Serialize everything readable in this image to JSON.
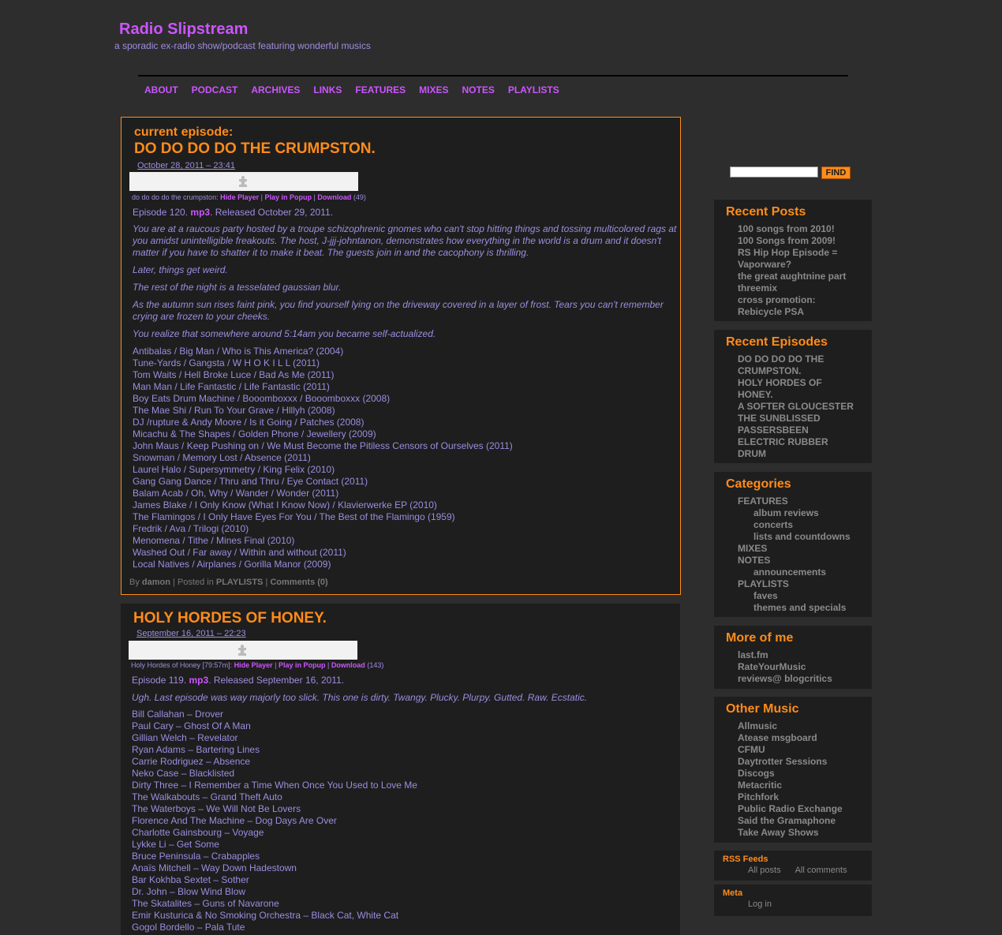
{
  "site": {
    "title": "Radio Slipstream",
    "description": "a sporadic ex-radio show/podcast featuring wonderful musics"
  },
  "nav": [
    "ABOUT",
    "PODCAST",
    "ARCHIVES",
    "LINKS",
    "FEATURES",
    "MIXES",
    "NOTES",
    "PLAYLISTS"
  ],
  "post1": {
    "label": "current episode:",
    "title": "DO DO DO DO THE CRUMPSTON.",
    "date": "October 28, 2011 – 23:41",
    "player_name": "do do do do the crumpston:",
    "hide_player": "Hide Player",
    "play_popup": "Play in Popup",
    "download": "Download",
    "download_count": "(49)",
    "episode_prefix": "Episode 120.",
    "mp3": "mp3",
    "episode_suffix": ". Released October 29, 2011.",
    "desc": [
      "You are at a raucous party hosted by a troupe schizophrenic gnomes who can't stop hitting things and tossing multicolored rags at you amidst unintelligible freakouts. The host, J-jjj-johntanon, demonstrates how everything in the world is a drum and it doesn't matter if you have to shatter it to make it beat. The guests join in and the cacophony is thrilling.",
      "Later, things get weird.",
      "The rest of the night is a tesselated gaussian blur.",
      "As the autumn sun rises faint pink, you find yourself lying on the driveway covered in a layer of frost. Tears you can't remember crying are frozen to your cheeks.",
      "You realize that somewhere around 5:14am you became self-actualized."
    ],
    "tracks": [
      "Antibalas / Big Man / Who is This America? (2004)",
      "Tune-Yards / Gangsta / W H O K I L L (2011)",
      "Tom Waits / Hell Broke Luce / Bad As Me (2011)",
      "Man Man / Life Fantastic / Life Fantastic (2011)",
      "Boy Eats Drum Machine / Booomboxxx / Booomboxxx (2008)",
      "The Mae Shi / Run To Your Grave / Hlllyh (2008)",
      "DJ /rupture & Andy Moore / Is it Going / Patches (2008)",
      "Micachu & The Shapes / Golden Phone / Jewellery (2009)",
      "John Maus / Keep Pushing on / We Must Become the Pitiless Censors of Ourselves (2011)",
      "Snowman / Memory Lost / Absence (2011)",
      "Laurel Halo / Supersymmetry / King Felix (2010)",
      "Gang Gang Dance / Thru and Thru / Eye Contact (2011)",
      "Balam Acab / Oh, Why / Wander / Wonder (2011)",
      "James Blake / I Only Know (What I Know Now) / Klavierwerke EP (2010)",
      "The Flamingos / I Only Have Eyes For You / The Best of the Flamingo (1959)",
      "Fredrik / Ava / Trilogi (2010)",
      "Menomena / Tithe / Mines Final (2010)",
      "Washed Out / Far away / Within and without (2011)",
      "Local Natives / Airplanes / Gorilla Manor (2009)"
    ],
    "meta_by": "By",
    "meta_author": "damon",
    "meta_posted": "| Posted in",
    "meta_category": "PLAYLISTS",
    "meta_sep": "|",
    "meta_comments": "Comments (0)"
  },
  "post2": {
    "title": "HOLY HORDES OF HONEY.",
    "date": "September 16, 2011 – 22:23",
    "player_name": "Holy Hordes of Honey [79:57m]:",
    "hide_player": "Hide Player",
    "play_popup": "Play in Popup",
    "download": "Download",
    "download_count": "(143)",
    "episode_prefix": "Episode 119.",
    "mp3": "mp3",
    "episode_suffix": ". Released September 16, 2011.",
    "desc": "Ugh. Last episode was way majorly too slick. This one is dirty. Twangy. Plucky. Plurpy. Gutted. Raw. Ecstatic.",
    "tracks": [
      "Bill Callahan – Drover",
      "Paul Cary – Ghost Of A Man",
      "Gillian Welch – Revelator",
      "Ryan Adams – Bartering Lines",
      "Carrie Rodriguez – Absence",
      "Neko Case – Blacklisted",
      "Dirty Three – I Remember a Time When Once You Used to Love Me",
      "The Walkabouts – Grand Theft Auto",
      "The Waterboys – We Will Not Be Lovers",
      "Florence And The Machine – Dog Days Are Over",
      "Charlotte Gainsbourg – Voyage",
      "Lykke Li – Get Some",
      "Bruce Peninsula – Crabapples",
      "Anaïs Mitchell – Way Down Hadestown",
      "Bar Kokhba Sextet – Sother",
      "Dr. John – Blow Wind Blow",
      "The Skatalites – Guns of Navarone",
      "Emir Kusturica & No Smoking Orchestra – Black Cat, White Cat",
      "Gogol Bordello – Pala Tute"
    ]
  },
  "search": {
    "button": "FIND"
  },
  "sidebar": {
    "recent_posts": {
      "title": "Recent Posts",
      "items": [
        "100 songs from 2010!",
        "100 Songs from 2009!",
        "RS Hip Hop Episode =",
        "Vaporware?",
        "the great aughtnine part",
        "threemix",
        "cross promotion:",
        "Rebicycle PSA"
      ]
    },
    "recent_episodes": {
      "title": "Recent Episodes",
      "items": [
        "DO DO DO DO THE",
        "CRUMPSTON.",
        "HOLY HORDES OF",
        "HONEY.",
        "A SOFTER GLOUCESTER",
        "THE SUNBLISSED",
        "PASSERSBEEN",
        "ELECTRIC RUBBER",
        "DRUM"
      ]
    },
    "categories": {
      "title": "Categories",
      "items": [
        {
          "label": "FEATURES",
          "sub": false
        },
        {
          "label": "album reviews",
          "sub": true
        },
        {
          "label": "concerts",
          "sub": true
        },
        {
          "label": "lists and countdowns",
          "sub": true
        },
        {
          "label": "MIXES",
          "sub": false
        },
        {
          "label": "NOTES",
          "sub": false
        },
        {
          "label": "announcements",
          "sub": true
        },
        {
          "label": "PLAYLISTS",
          "sub": false
        },
        {
          "label": "faves",
          "sub": true
        },
        {
          "label": "themes and specials",
          "sub": true
        }
      ]
    },
    "more_of_me": {
      "title": "More of me",
      "items": [
        "last.fm",
        "RateYourMusic",
        "reviews@ blogcritics"
      ]
    },
    "other_music": {
      "title": "Other Music",
      "items": [
        "Allmusic",
        "Atease msgboard",
        "CFMU",
        "Daytrotter Sessions",
        "Discogs",
        "Metacritic",
        "Pitchfork",
        "Public Radio Exchange",
        "Said the Gramaphone",
        "Take Away Shows"
      ]
    },
    "rss": {
      "title": "RSS Feeds",
      "all_posts": "All posts",
      "all_comments": "All comments"
    },
    "meta": {
      "title": "Meta",
      "log_in": "Log in"
    }
  },
  "colors": {
    "background": "#2d2d2d",
    "panel": "#1e1e1e",
    "accent_orange": "#ff8c1a",
    "accent_purple": "#cc55ff",
    "text_lavender": "#9a8ee0"
  }
}
